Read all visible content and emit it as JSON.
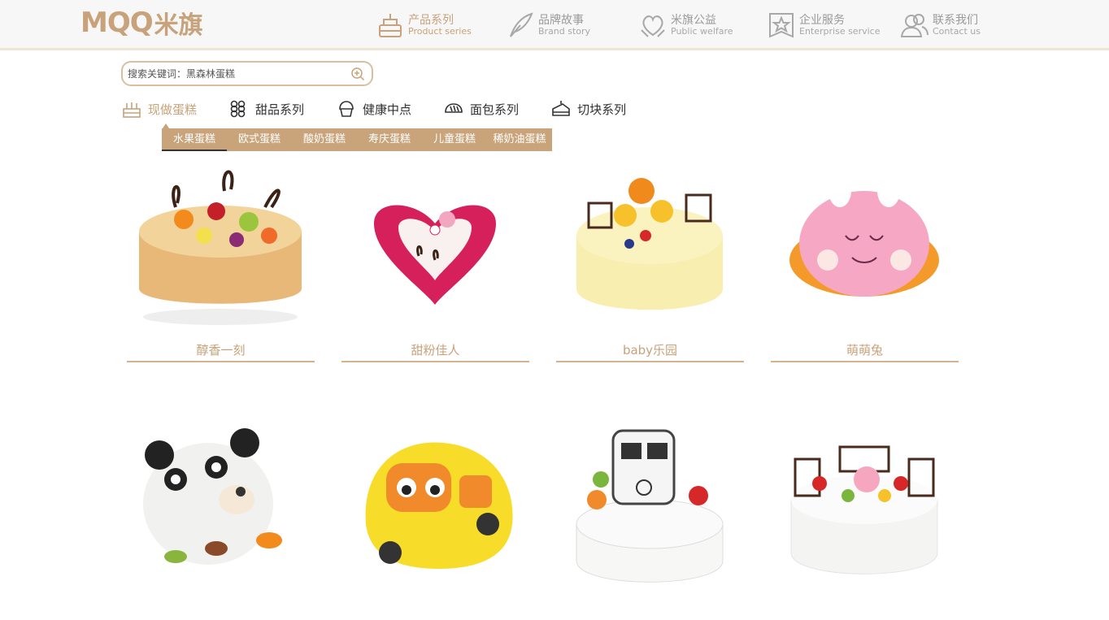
{
  "brand": {
    "logo_latin": "MQQ",
    "logo_cn": "米旗"
  },
  "nav": [
    {
      "cn": "产品系列",
      "en": "Product series",
      "icon": "cake-icon",
      "active": true
    },
    {
      "cn": "品牌故事",
      "en": "Brand story",
      "icon": "feather-icon",
      "active": false
    },
    {
      "cn": "米旗公益",
      "en": "Public welfare",
      "icon": "heart-hands-icon",
      "active": false
    },
    {
      "cn": "企业服务",
      "en": "Enterprise service",
      "icon": "star-badge-icon",
      "active": false
    },
    {
      "cn": "联系我们",
      "en": "Contact us",
      "icon": "people-icon",
      "active": false
    }
  ],
  "search": {
    "placeholder": "搜索关键词：黑森林蛋糕"
  },
  "categories": [
    {
      "label": "现做蛋糕",
      "icon": "cake-tier-icon",
      "active": true
    },
    {
      "label": "甜品系列",
      "icon": "dots-grid-icon",
      "active": false
    },
    {
      "label": "健康中点",
      "icon": "muffin-icon",
      "active": false
    },
    {
      "label": "面包系列",
      "icon": "bread-icon",
      "active": false
    },
    {
      "label": "切块系列",
      "icon": "cake-slice-icon",
      "active": false
    }
  ],
  "subtabs": [
    "水果蛋糕",
    "欧式蛋糕",
    "酸奶蛋糕",
    "寿庆蛋糕",
    "儿童蛋糕",
    "稀奶油蛋糕"
  ],
  "products": [
    {
      "name": "醇香一刻"
    },
    {
      "name": "甜粉佳人"
    },
    {
      "name": "baby乐园"
    },
    {
      "name": "萌萌兔"
    },
    {
      "name": ""
    },
    {
      "name": ""
    },
    {
      "name": ""
    },
    {
      "name": ""
    }
  ],
  "colors": {
    "accent": "#c8a27a",
    "subtab_bg": "#c9a47a",
    "header_bg": "#f7f7f7"
  }
}
